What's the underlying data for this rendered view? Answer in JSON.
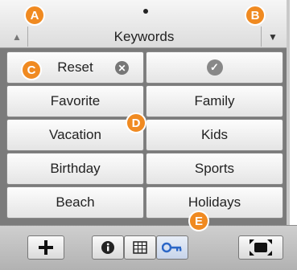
{
  "header": {
    "title": "Keywords",
    "left_arrow": "▲",
    "right_arrow": "▼"
  },
  "keywords": {
    "rows": [
      [
        {
          "label": "Reset"
        },
        {
          "label": ""
        }
      ],
      [
        {
          "label": "Favorite"
        },
        {
          "label": "Family"
        }
      ],
      [
        {
          "label": "Vacation"
        },
        {
          "label": "Kids"
        }
      ],
      [
        {
          "label": "Birthday"
        },
        {
          "label": "Sports"
        }
      ],
      [
        {
          "label": "Beach"
        },
        {
          "label": "Holidays"
        }
      ]
    ]
  },
  "callouts": {
    "a": "A",
    "b": "B",
    "c": "C",
    "d": "D",
    "e": "E"
  },
  "toolbar": {
    "add_icon": "plus-icon",
    "info_icon": "info-icon",
    "grid_icon": "grid-icon",
    "key_icon": "key-icon",
    "fullscreen_icon": "fullscreen-icon"
  },
  "colors": {
    "callout": "#f08a21",
    "key_blue": "#2c67c7"
  }
}
